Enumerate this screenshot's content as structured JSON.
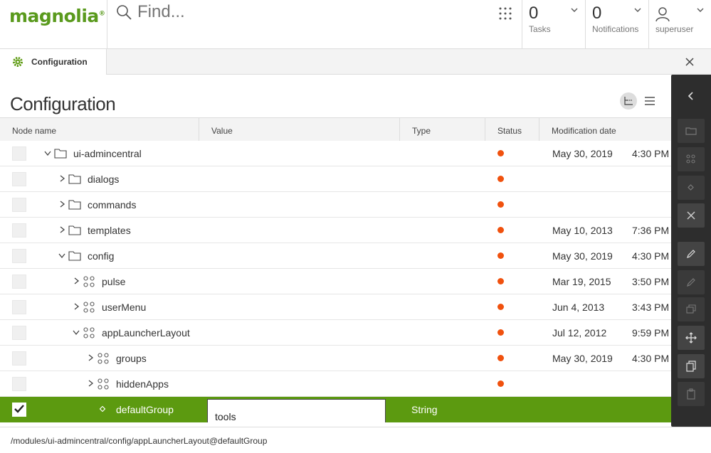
{
  "header": {
    "logo_text": "magnolia",
    "logo_mark": "®",
    "search_placeholder": "Find...",
    "tasks": {
      "count": "0",
      "label": "Tasks"
    },
    "notifications": {
      "count": "0",
      "label": "Notifications"
    },
    "user": {
      "name": "superuser"
    }
  },
  "tab": {
    "label": "Configuration"
  },
  "page": {
    "title": "Configuration"
  },
  "grid": {
    "columns": [
      "Node name",
      "Value",
      "Type",
      "Status",
      "Modification date"
    ],
    "rows": [
      {
        "name": "ui-admincentral",
        "kind": "folder",
        "expanded": true,
        "date": "May 30, 2019",
        "time": "4:30 PM"
      },
      {
        "name": "dialogs",
        "kind": "folder",
        "expanded": false,
        "date": "",
        "time": ""
      },
      {
        "name": "commands",
        "kind": "folder",
        "expanded": false,
        "date": "",
        "time": ""
      },
      {
        "name": "templates",
        "kind": "folder",
        "expanded": false,
        "date": "May 10, 2013",
        "time": "7:36 PM"
      },
      {
        "name": "config",
        "kind": "folder",
        "expanded": true,
        "date": "May 30, 2019",
        "time": "4:30 PM"
      },
      {
        "name": "pulse",
        "kind": "content",
        "expanded": false,
        "date": "Mar 19, 2015",
        "time": "3:50 PM"
      },
      {
        "name": "userMenu",
        "kind": "content",
        "expanded": false,
        "date": "Jun 4, 2013",
        "time": "3:43 PM"
      },
      {
        "name": "appLauncherLayout",
        "kind": "content",
        "expanded": true,
        "date": "Jul 12, 2012",
        "time": "9:59 PM"
      },
      {
        "name": "groups",
        "kind": "content",
        "expanded": false,
        "date": "May 30, 2019",
        "time": "4:30 PM"
      },
      {
        "name": "hiddenApps",
        "kind": "content",
        "expanded": false,
        "date": "",
        "time": ""
      }
    ],
    "selected": {
      "name": "defaultGroup",
      "value": "tools",
      "type": "String"
    }
  },
  "path": "/modules/ui-admincentral/config/appLauncherLayout@defaultGroup",
  "colors": {
    "accent": "#5c9a10",
    "status": "#f0510e",
    "actionbar": "#2d2d2d"
  }
}
